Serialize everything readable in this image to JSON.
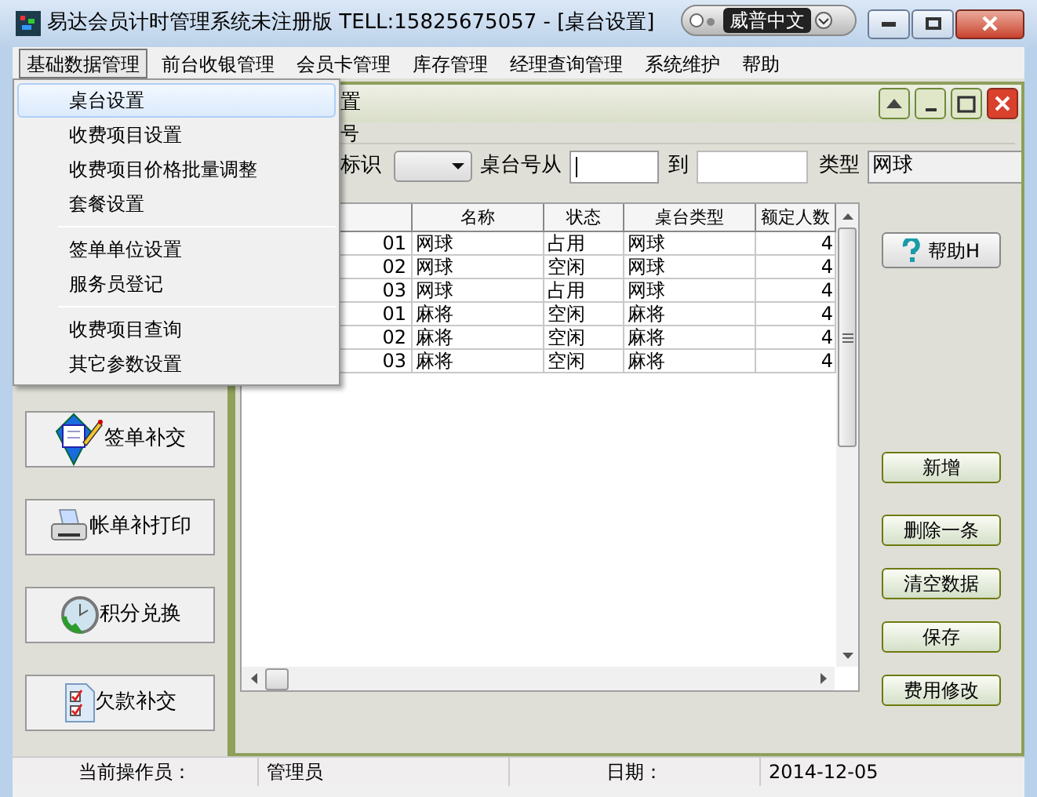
{
  "window": {
    "title": "易达会员计时管理系统未注册版 TELL:15825675057 - [桌台设置]"
  },
  "ime_bar": {
    "label": "威普中文"
  },
  "menu_bar": [
    {
      "label": "基础数据管理",
      "selected": true
    },
    {
      "label": "前台收银管理",
      "selected": false
    },
    {
      "label": "会员卡管理",
      "selected": false
    },
    {
      "label": "库存管理",
      "selected": false
    },
    {
      "label": "经理查询管理",
      "selected": false
    },
    {
      "label": "系统维护",
      "selected": false
    },
    {
      "label": "帮助",
      "selected": false
    }
  ],
  "dropdown_menu": {
    "groups": [
      [
        {
          "label": "桌台设置",
          "selected": true
        },
        {
          "label": "收费项目设置",
          "selected": false
        },
        {
          "label": "收费项目价格批量调整",
          "selected": false
        },
        {
          "label": "套餐设置",
          "selected": false
        }
      ],
      [
        {
          "label": "签单单位设置",
          "selected": false
        },
        {
          "label": "服务员登记",
          "selected": false
        }
      ],
      [
        {
          "label": "收费项目查询",
          "selected": false
        },
        {
          "label": "其它参数设置",
          "selected": false
        }
      ]
    ]
  },
  "left_panel": {
    "buttons": [
      {
        "label": "签单补交",
        "kind": "sign"
      },
      {
        "label": "帐单补打印",
        "kind": "print"
      },
      {
        "label": "积分兑换",
        "kind": "points"
      },
      {
        "label": "欠款补交",
        "kind": "debt"
      }
    ]
  },
  "child_window": {
    "title": "置",
    "group_label": "号",
    "filters": {
      "id_label": "标识",
      "from_label": "桌台号从",
      "to_label": "到",
      "type_label": "类型",
      "type_value": "网球"
    },
    "table": {
      "columns": [
        "",
        "名称",
        "状态",
        "桌台类型",
        "额定人数"
      ],
      "rows": [
        [
          "01",
          "网球",
          "占用",
          "网球",
          "4"
        ],
        [
          "02",
          "网球",
          "空闲",
          "网球",
          "4"
        ],
        [
          "03",
          "网球",
          "占用",
          "网球",
          "4"
        ],
        [
          "01",
          "麻将",
          "空闲",
          "麻将",
          "4"
        ],
        [
          "02",
          "麻将",
          "空闲",
          "麻将",
          "4"
        ],
        [
          "03",
          "麻将",
          "空闲",
          "麻将",
          "4"
        ]
      ]
    },
    "buttons": [
      {
        "label": "帮助H",
        "kind": "help"
      },
      {
        "label": "新增",
        "kind": "action"
      },
      {
        "label": "删除一条",
        "kind": "action"
      },
      {
        "label": "清空数据",
        "kind": "action"
      },
      {
        "label": "保存",
        "kind": "action"
      },
      {
        "label": "费用修改",
        "kind": "action"
      }
    ]
  },
  "status_bar": {
    "operator_label": "当前操作员：",
    "operator": "管理员",
    "date_label": "日期：",
    "date": "2014-12-05"
  }
}
